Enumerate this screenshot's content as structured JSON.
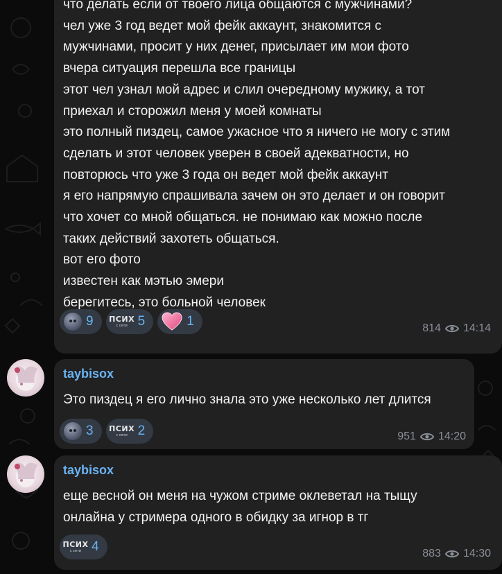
{
  "messages": [
    {
      "text": "что делать если от твоего лица общаются с мужчинами?\nчел уже 3 год ведет мой фейк аккаунт, знакомится с\nмужчинами, просит у них денег, присылает им мои фото\nвчера ситуация перешла все границы\nэтот чел узнал мой адрес и слил очередному мужику, а тот\nприехал и сторожил меня у моей комнаты\nэто полный пиздец, самое ужасное что я ничего не могу с этим\nсделать и этот человек уверен в своей адекватности, но\nповторюсь что уже 3 года он ведет мой фейк аккаунт\nя его напрямую спрашивала зачем он это делает и он говорит\nчто хочет со мной общаться. не понимаю как можно после\nтаких действий захотеть общаться.\nвот его фото\nизвестен как мэтью эмери\nберегитесь, это больной человек",
      "reactions": [
        {
          "icon": "moon-face-emoji",
          "count": "9"
        },
        {
          "icon": "psih-sticker-emoji",
          "label": "ПСИХ",
          "sublabel": "с сети",
          "count": "5"
        },
        {
          "icon": "heart-emoji",
          "count": "1"
        }
      ],
      "views": "814",
      "time": "14:14"
    },
    {
      "author": "taybisox",
      "text": "Это пиздец я его лично знала это уже несколько лет длится",
      "reactions": [
        {
          "icon": "moon-face-emoji",
          "count": "3"
        },
        {
          "icon": "psih-sticker-emoji",
          "label": "ПСИХ",
          "sublabel": "с сети",
          "count": "2"
        }
      ],
      "views": "951",
      "time": "14:20"
    },
    {
      "author": "taybisox",
      "text": "еще весной он меня на чужом стриме оклеветал на тыщу\nонлайна у стримера одного в обидку за игнор в тг",
      "reactions": [
        {
          "icon": "psih-sticker-emoji",
          "label": "ПСИХ",
          "sublabel": "с сети",
          "count": "4"
        }
      ],
      "views": "883",
      "time": "14:30"
    }
  ],
  "colors": {
    "background": "#0b0b0c",
    "bubble": "#212121",
    "reaction_bg": "#333a44",
    "accent": "#6ab3f3",
    "meta": "#8a8f97"
  }
}
